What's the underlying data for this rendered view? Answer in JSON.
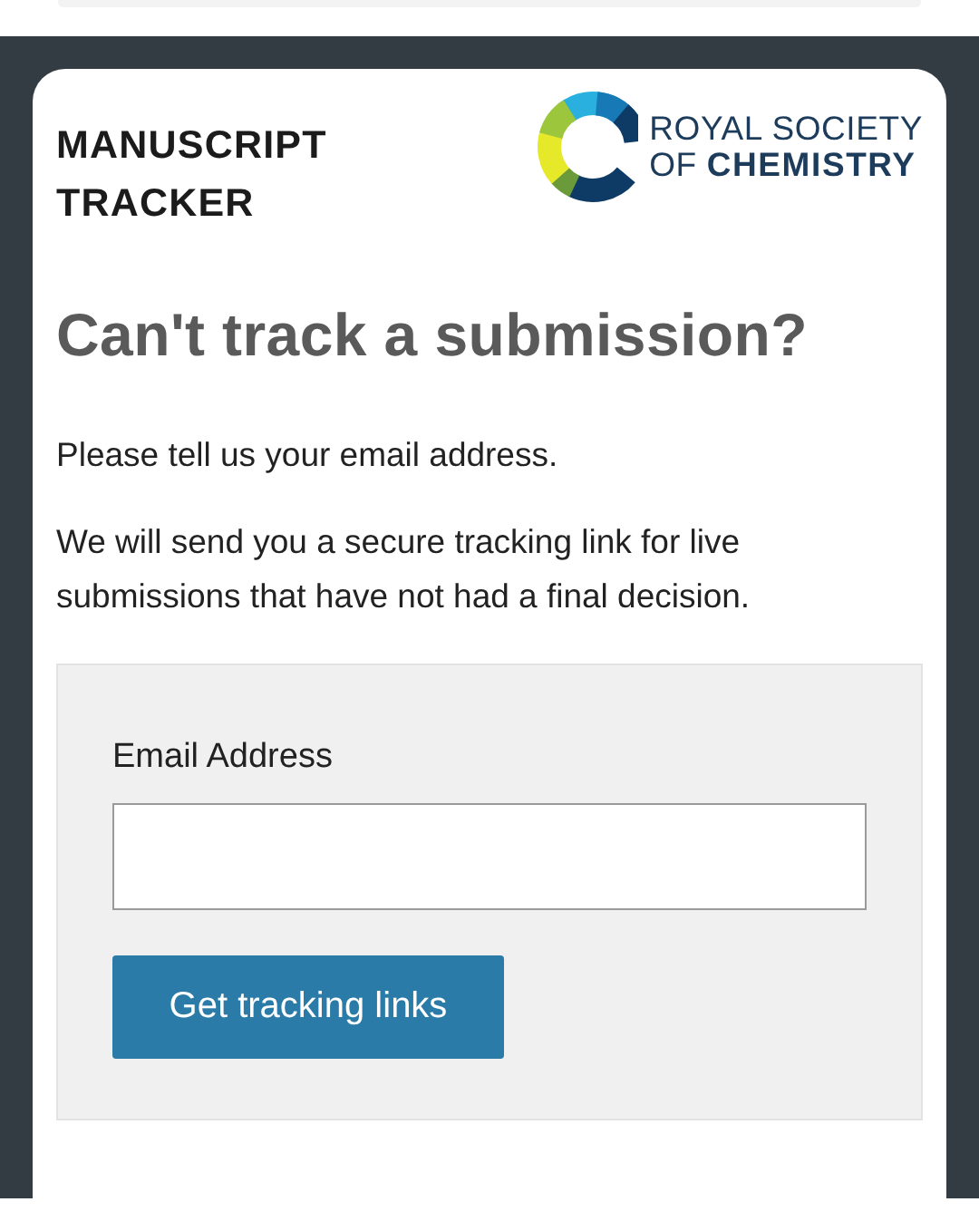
{
  "header": {
    "title": "MANUSCRIPT TRACKER",
    "logo": {
      "line_1": "ROYAL SOCIETY",
      "line_2": "OF **CHEMISTRY**"
    }
  },
  "heading": "Can't track a submission?",
  "paragraphs": [
    "Please tell us your email address.",
    "We will send you a secure tracking link for live submissions that have not had a final decision."
  ],
  "form": {
    "label": "Email Address",
    "button": "Get tracking links"
  }
}
